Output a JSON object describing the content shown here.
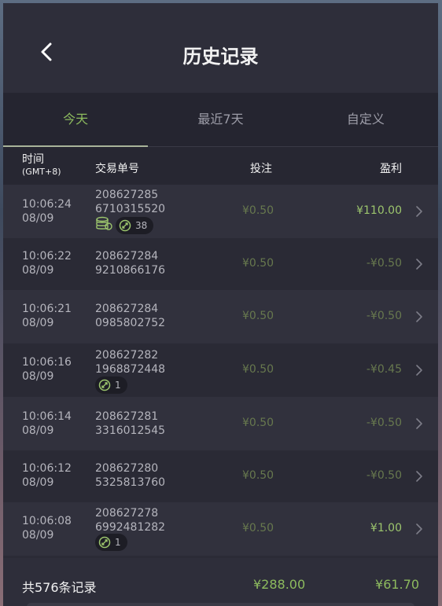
{
  "header": {
    "title": "历史记录"
  },
  "tabs": [
    {
      "label": "今天",
      "active": true
    },
    {
      "label": "最近7天",
      "active": false
    },
    {
      "label": "自定义",
      "active": false
    }
  ],
  "columns": {
    "time": "时间",
    "timezone": "(GMT+8)",
    "order": "交易单号",
    "bet": "投注",
    "profit": "盈利"
  },
  "rows": [
    {
      "time": "10:06:24",
      "date": "08/09",
      "order1": "208627285",
      "order2": "6710315520",
      "bet": "¥0.50",
      "profit": "¥110.00",
      "profit_sign": "pos",
      "coins": true,
      "count": "38"
    },
    {
      "time": "10:06:22",
      "date": "08/09",
      "order1": "208627284",
      "order2": "9210866176",
      "bet": "¥0.50",
      "profit": "-¥0.50",
      "profit_sign": "neg"
    },
    {
      "time": "10:06:21",
      "date": "08/09",
      "order1": "208627284",
      "order2": "0985802752",
      "bet": "¥0.50",
      "profit": "-¥0.50",
      "profit_sign": "neg"
    },
    {
      "time": "10:06:16",
      "date": "08/09",
      "order1": "208627282",
      "order2": "1968872448",
      "bet": "¥0.50",
      "profit": "-¥0.45",
      "profit_sign": "neg",
      "count": "1"
    },
    {
      "time": "10:06:14",
      "date": "08/09",
      "order1": "208627281",
      "order2": "3316012545",
      "bet": "¥0.50",
      "profit": "-¥0.50",
      "profit_sign": "neg"
    },
    {
      "time": "10:06:12",
      "date": "08/09",
      "order1": "208627280",
      "order2": "5325813760",
      "bet": "¥0.50",
      "profit": "-¥0.50",
      "profit_sign": "neg"
    },
    {
      "time": "10:06:08",
      "date": "08/09",
      "order1": "208627278",
      "order2": "6992481282",
      "bet": "¥0.50",
      "profit": "¥1.00",
      "profit_sign": "pos",
      "count": "1"
    }
  ],
  "footer": {
    "total": "共576条记录",
    "bet_sum": "¥288.00",
    "profit_sum": "¥61.70"
  },
  "icons": {
    "back": "chevron-left-icon",
    "row": "chevron-right-icon",
    "coins": "coin-stack-icon",
    "feature": "spin-arrows-icon"
  },
  "colors": {
    "accent": "#8dbb5e",
    "negative": "#67784e",
    "background": "#2b2b36"
  }
}
